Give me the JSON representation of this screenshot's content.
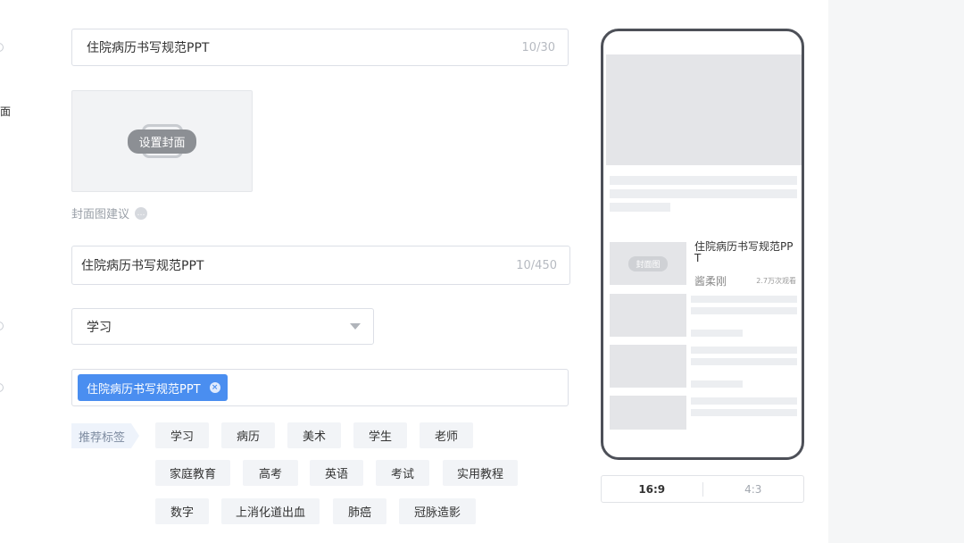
{
  "left_labels": {
    "cover_partial": "面"
  },
  "title_field": {
    "value": "住院病历书写规范PPT",
    "count": "10/30"
  },
  "cover": {
    "button_label": "设置封面",
    "hint": "封面图建议",
    "hint_icon": "chat-bubble-icon"
  },
  "description_field": {
    "value": "住院病历书写规范PPT",
    "count": "10/450"
  },
  "category_field": {
    "value": "学习",
    "icon": "caret-down-icon"
  },
  "tags_field": {
    "chip": "住院病历书写规范PPT",
    "remove_icon": "close-circle-icon"
  },
  "recommended": {
    "label": "推荐标签",
    "tags": [
      "学习",
      "病历",
      "美术",
      "学生",
      "老师",
      "家庭教育",
      "高考",
      "英语",
      "考试",
      "实用教程",
      "数字",
      "上消化道出血",
      "肺癌",
      "冠脉造影"
    ]
  },
  "preview": {
    "cover_label": "封面图",
    "title": "住院病历书写规范PPT",
    "author": "酱柔刚",
    "views": "2.7万次观看"
  },
  "ratio": {
    "active": "16:9",
    "inactive": "4:3"
  },
  "colors": {
    "accent": "#4a8ef0",
    "phone_frame": "#4d5058"
  }
}
